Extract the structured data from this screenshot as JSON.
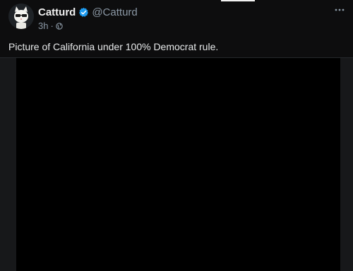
{
  "post": {
    "display_name": "Catturd",
    "handle": "@Catturd",
    "time": "3h",
    "separator": "·",
    "text": "Picture of California under 100% Democrat rule."
  },
  "icons": {
    "verified": "verified-badge-icon",
    "visibility": "globe-icon",
    "more": "more-options-icon"
  },
  "colors": {
    "verified": "#1d9bf0",
    "secondary_text": "#8b98a5",
    "background": "#0d0d0e",
    "media": "#000000"
  }
}
